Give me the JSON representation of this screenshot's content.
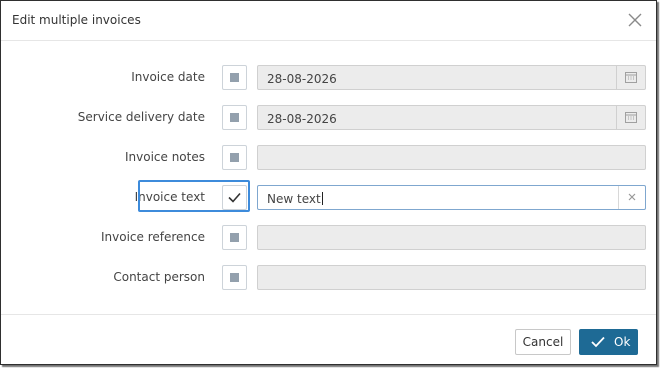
{
  "dialog": {
    "title": "Edit multiple invoices",
    "icons": {
      "close": "close-icon",
      "calendar": "calendar-icon",
      "checkbox_checked": "checkmark-icon",
      "clear": "clear-icon"
    }
  },
  "fields": [
    {
      "label": "Invoice date",
      "checked": false,
      "value": "28-08-2026",
      "type": "date"
    },
    {
      "label": "Service delivery date",
      "checked": false,
      "value": "28-08-2026",
      "type": "date"
    },
    {
      "label": "Invoice notes",
      "checked": false,
      "value": "",
      "type": "text"
    },
    {
      "label": "Invoice text",
      "checked": true,
      "value": "New text",
      "type": "text",
      "active": true
    },
    {
      "label": "Invoice reference",
      "checked": false,
      "value": "",
      "type": "text"
    },
    {
      "label": "Contact person",
      "checked": false,
      "value": "",
      "type": "text"
    }
  ],
  "footer": {
    "cancel_label": "Cancel",
    "ok_label": "Ok"
  },
  "colors": {
    "primary": "#1e6a95",
    "highlight": "#3d8bdb",
    "disabled_field": "#ececec",
    "checkbox_square": "#93a0ad"
  }
}
